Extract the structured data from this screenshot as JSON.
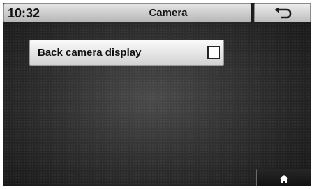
{
  "header": {
    "time": "10:32",
    "title": "Camera",
    "back_icon": "back-arrow-icon"
  },
  "settings": {
    "options": [
      {
        "label": "Back camera display",
        "checked": false
      }
    ]
  },
  "footer": {
    "home_icon": "home-icon"
  }
}
